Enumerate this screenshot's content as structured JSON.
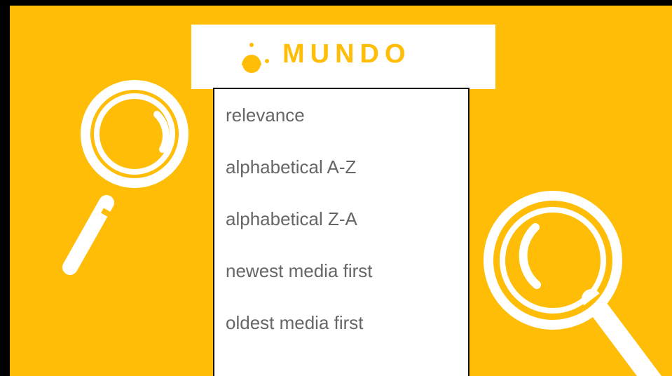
{
  "brand": {
    "name": "MUNDO",
    "accent_color": "#FFBD08",
    "logo_icon": "mundo-dot-logo-icon"
  },
  "background_icons": [
    "magnifier-icon",
    "magnifier-icon"
  ],
  "sort_menu": {
    "options": [
      {
        "label": "relevance"
      },
      {
        "label": "alphabetical A-Z"
      },
      {
        "label": "alphabetical Z-A"
      },
      {
        "label": "newest media first"
      },
      {
        "label": "oldest media first"
      }
    ]
  }
}
